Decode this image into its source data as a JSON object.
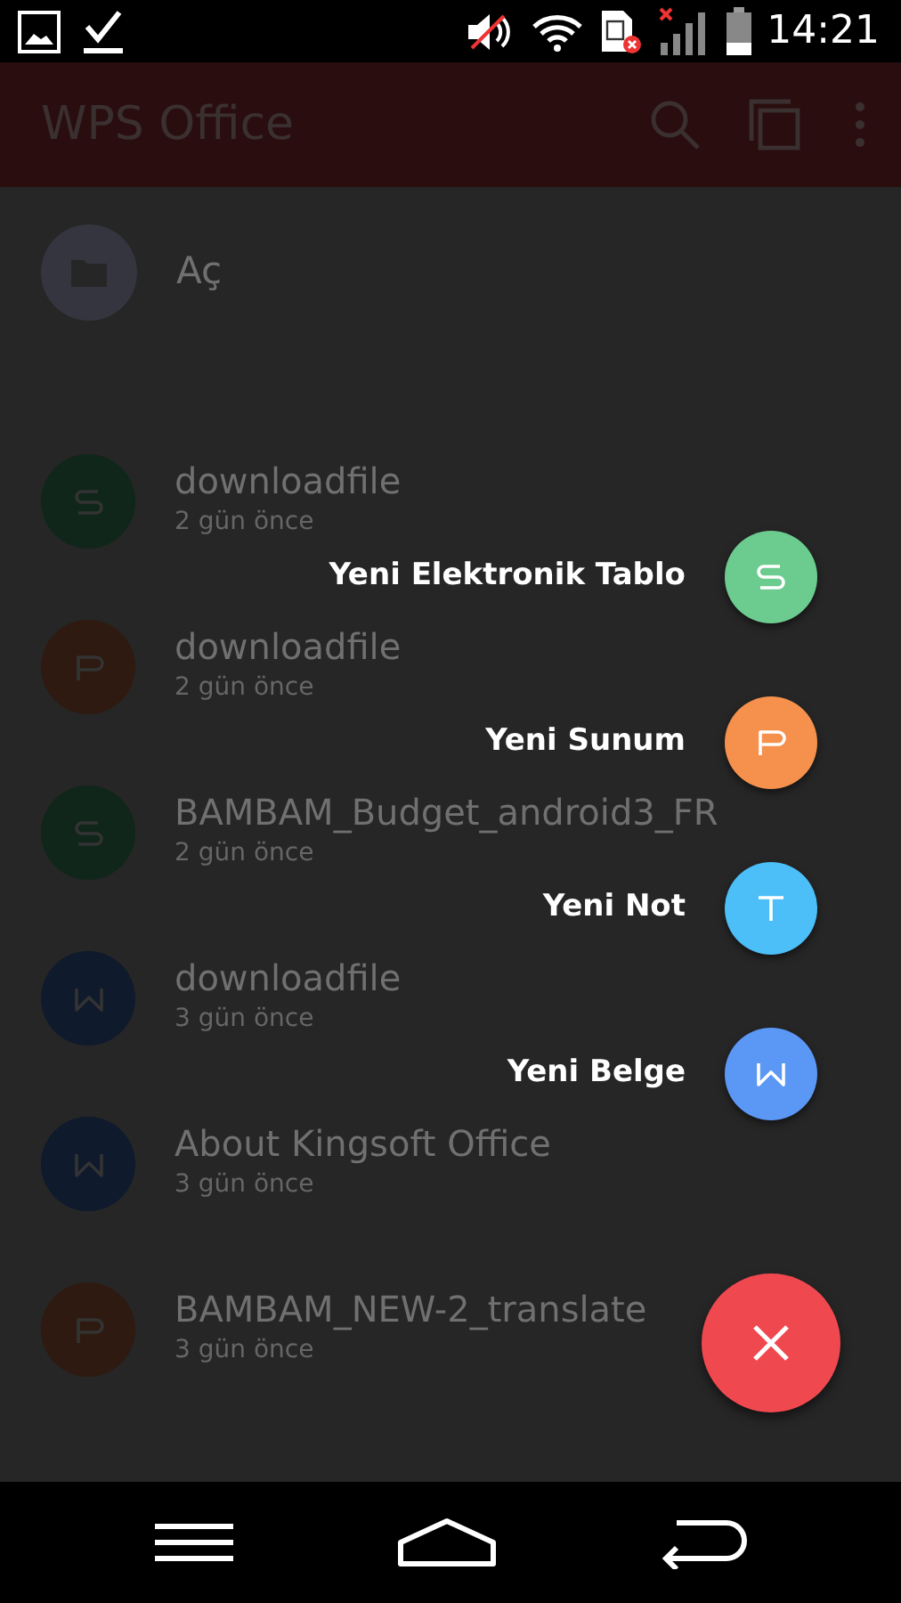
{
  "status_bar": {
    "time": "14:21"
  },
  "app_bar": {
    "title": "WPS Office"
  },
  "open_item": {
    "label": "Aç"
  },
  "files": [
    {
      "name": "downloadfile",
      "date": "2 gün önce",
      "kind": "spreadsheet"
    },
    {
      "name": "downloadfile",
      "date": "2 gün önce",
      "kind": "presentation"
    },
    {
      "name": "BAMBAM_Budget_android3_FR",
      "date": "2 gün önce",
      "kind": "spreadsheet"
    },
    {
      "name": "downloadfile",
      "date": "3 gün önce",
      "kind": "document"
    },
    {
      "name": "About Kingsoft Office",
      "date": "3 gün önce",
      "kind": "document"
    },
    {
      "name": "BAMBAM_NEW-2_translate",
      "date": "3 gün önce",
      "kind": "presentation"
    }
  ],
  "fab_menu": [
    {
      "label": "Yeni Elektronik Tablo",
      "kind": "spreadsheet"
    },
    {
      "label": "Yeni Sunum",
      "kind": "presentation"
    },
    {
      "label": "Yeni Not",
      "kind": "note"
    },
    {
      "label": "Yeni Belge",
      "kind": "document"
    }
  ],
  "fab_expanded": true
}
